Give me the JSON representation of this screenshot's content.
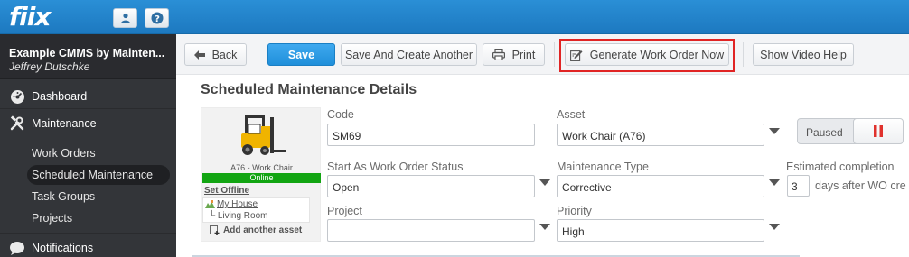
{
  "app": {
    "logo": "fiix"
  },
  "sidebar": {
    "company": "Example CMMS by Mainten...",
    "user": "Jeffrey Dutschke",
    "items": [
      {
        "label": "Dashboard",
        "icon": "dashboard-icon"
      },
      {
        "label": "Maintenance",
        "icon": "tools-icon"
      },
      {
        "label": "Notifications",
        "icon": "chat-icon"
      }
    ],
    "subitems": [
      "Work Orders",
      "Scheduled Maintenance",
      "Task Groups",
      "Projects"
    ],
    "active_subitem": "Scheduled Maintenance"
  },
  "toolbar": {
    "back": "Back",
    "save": "Save",
    "save_another": "Save And Create Another",
    "print": "Print",
    "generate": "Generate Work Order Now",
    "video_help": "Show Video Help"
  },
  "page": {
    "title": "Scheduled Maintenance Details"
  },
  "asset_card": {
    "name": "A76 - Work Chair",
    "status": "Online",
    "set_offline": "Set Offline",
    "location": "My House",
    "sublocation": "Living Room",
    "add_asset": "Add another asset"
  },
  "form": {
    "code_label": "Code",
    "code_value": "SM69",
    "asset_label": "Asset",
    "asset_value": "Work Chair (A76)",
    "status_label": "Start As Work Order Status",
    "status_value": "Open",
    "mtype_label": "Maintenance Type",
    "mtype_value": "Corrective",
    "project_label": "Project",
    "project_value": "",
    "priority_label": "Priority",
    "priority_value": "High",
    "est_label": "Estimated completion",
    "est_value": "3",
    "est_suffix": "days after WO cre",
    "paused_label": "Paused"
  },
  "colors": {
    "topbar": "#2a8fd6",
    "sidebar": "#333539",
    "save": "#1f8fda",
    "online": "#12a512",
    "highlight": "#e02424",
    "pause": "#e0322d"
  }
}
